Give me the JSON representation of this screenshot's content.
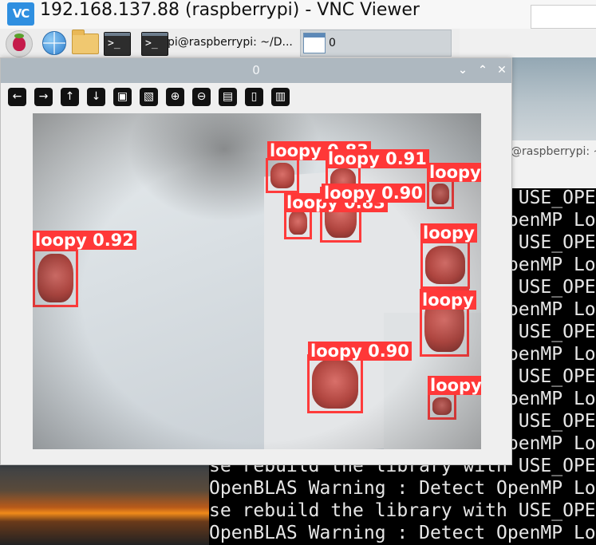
{
  "vnc": {
    "logo_text": "VC",
    "title": "192.168.137.88 (raspberrypi) - VNC Viewer"
  },
  "taskbar": {
    "icons": [
      "raspberry-icon",
      "globe-icon",
      "folder-icon",
      "terminal-icon"
    ],
    "terminal_task_label": "pi@raspberrypi: ~/D...",
    "window_task_label": "0"
  },
  "background": {
    "terminal_title": "@raspberrypi: ~"
  },
  "terminal": {
    "lines": [
      "se rebuild the library with USE_OPE",
      "OpenBLAS Warning : Detect OpenMP Lo",
      "se rebuild the library with USE_OPE",
      "OpenBLAS Warning : Detect OpenMP Lo",
      "se rebuild the library with USE_OPE",
      "OpenBLAS Warning : Detect OpenMP Lo",
      "se rebuild the library with USE_OPE",
      "OpenBLAS Warning : Detect OpenMP Lo",
      "se rebuild the library with USE_OPE",
      "OpenBLAS Warning : Detect OpenMP Lo",
      "se rebuild the library with USE_OPE",
      "OpenBLAS Warning : Detect OpenMP Lo",
      "se rebuild the library with USE_OPE",
      "OpenBLAS Warning : Detect OpenMP Lo",
      "se rebuild the library with USE_OPE",
      "OpenBLAS Warning : Detect OpenMP Lo"
    ]
  },
  "image_window": {
    "title": "0",
    "controls": {
      "minimize": "⌄",
      "maximize": "⌃",
      "close": "✕"
    },
    "toolbar": [
      {
        "name": "back-arrow-icon",
        "glyph": "←"
      },
      {
        "name": "forward-arrow-icon",
        "glyph": "→"
      },
      {
        "name": "up-arrow-icon",
        "glyph": "↑"
      },
      {
        "name": "down-arrow-icon",
        "glyph": "↓"
      },
      {
        "name": "image-icon",
        "glyph": "▣"
      },
      {
        "name": "image-settings-icon",
        "glyph": "▧"
      },
      {
        "name": "zoom-in-icon",
        "glyph": "⊕"
      },
      {
        "name": "zoom-out-icon",
        "glyph": "⊖"
      },
      {
        "name": "save-icon",
        "glyph": "▤"
      },
      {
        "name": "copy-icon",
        "glyph": "▯"
      },
      {
        "name": "paint-icon",
        "glyph": "▥"
      }
    ]
  },
  "detections": [
    {
      "label": "loopy 0.83"
    },
    {
      "label": "loopy 0.91"
    },
    {
      "label": "loopy"
    },
    {
      "label": "loopy 0.83"
    },
    {
      "label": "loopy 0.90"
    },
    {
      "label": "loopy 0.92"
    },
    {
      "label": "loopy"
    },
    {
      "label": "loopy"
    },
    {
      "label": "loopy 0.90"
    },
    {
      "label": "loopy"
    }
  ],
  "colors": {
    "detection_box": "#ff3b3b",
    "vnc_logo": "#2f8fe0",
    "terminal_bg": "#000000",
    "terminal_text": "#e6e6e6"
  }
}
